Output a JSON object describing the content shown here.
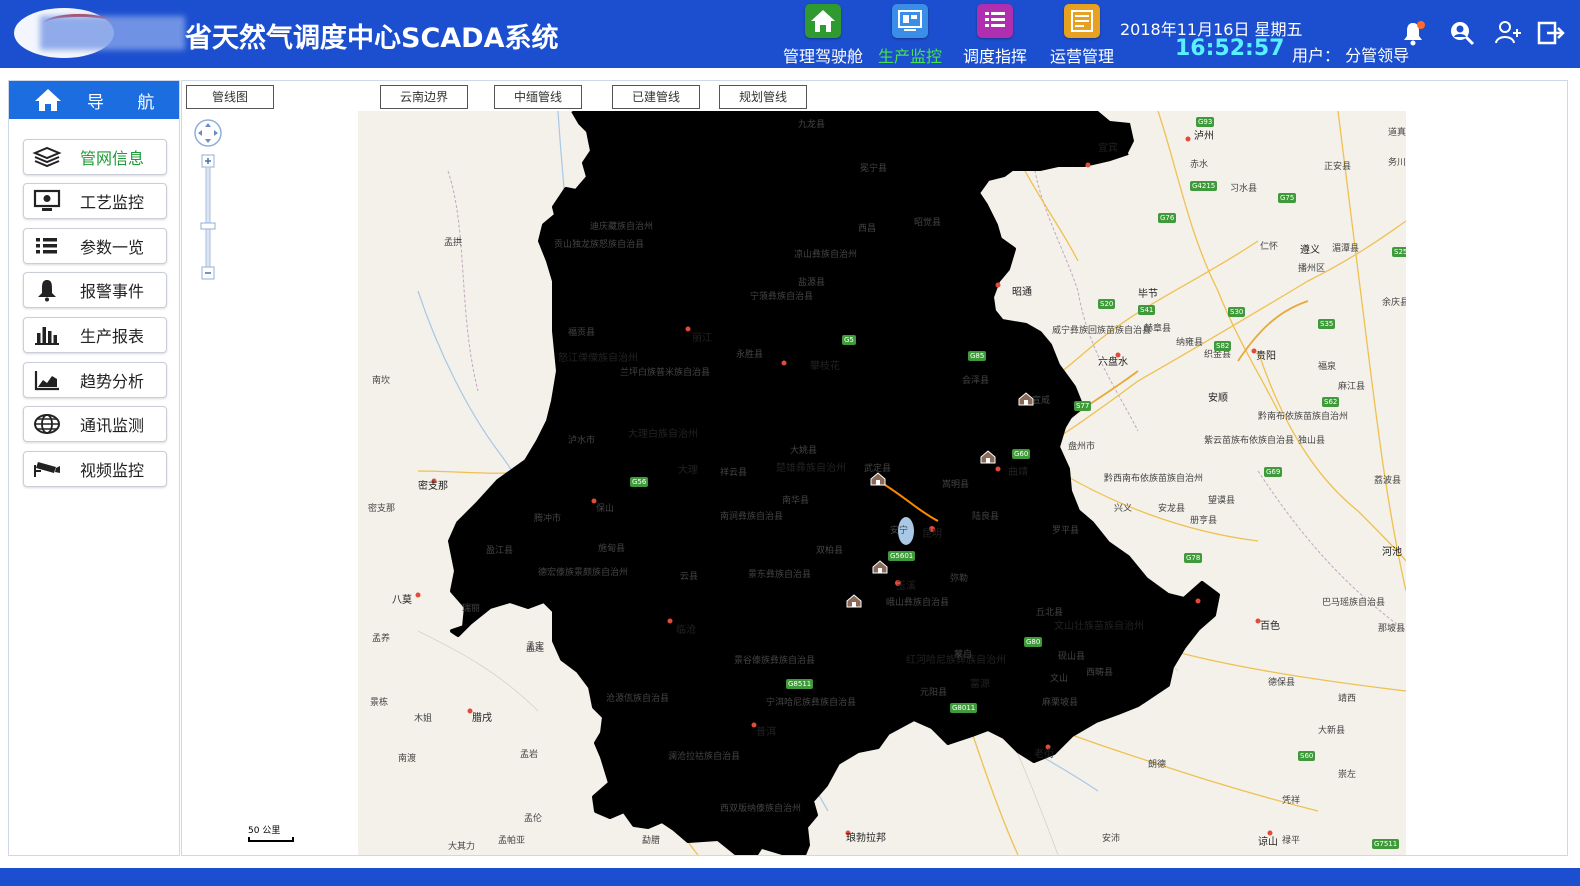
{
  "header": {
    "title": "省天然气调度中心SCADA系统",
    "nav": [
      {
        "label": "管理驾驶舱",
        "icon": "home-icon",
        "color": "#2f9a2f",
        "active": false
      },
      {
        "label": "生产监控",
        "icon": "monitor-screen-icon",
        "color": "#3a8ee8",
        "active": true
      },
      {
        "label": "调度指挥",
        "icon": "list-icon",
        "color": "#b02fb0",
        "active": false
      },
      {
        "label": "运营管理",
        "icon": "document-icon",
        "color": "#e8a020",
        "active": false
      }
    ],
    "date": "2018年11月16日  星期五",
    "time": "16:52:57",
    "user": "用户： 分管领导",
    "icons": [
      "bell-icon",
      "user-search-icon",
      "users-icon",
      "logout-icon"
    ]
  },
  "sidebar": {
    "title": "导 航",
    "items": [
      {
        "label": "管网信息",
        "icon": "layers-icon",
        "active": true
      },
      {
        "label": "工艺监控",
        "icon": "monitor-icon",
        "active": false
      },
      {
        "label": "参数一览",
        "icon": "list-icon",
        "active": false
      },
      {
        "label": "报警事件",
        "icon": "bell-icon",
        "active": false
      },
      {
        "label": "生产报表",
        "icon": "bar-chart-icon",
        "active": false
      },
      {
        "label": "趋势分析",
        "icon": "trend-chart-icon",
        "active": false
      },
      {
        "label": "通讯监测",
        "icon": "globe-icon",
        "active": false
      },
      {
        "label": "视频监控",
        "icon": "camera-icon",
        "active": false
      }
    ]
  },
  "tabs": [
    "管线图",
    "云南边界",
    "中缅管线",
    "已建管线",
    "规划管线"
  ],
  "map": {
    "scale": "50 公里",
    "places": [
      "九龙县",
      "冕宁县",
      "西昌",
      "昭觉县",
      "凉山彝族自治州",
      "盐源县",
      "宁蒗彝族自治县",
      "攀枝花",
      "永胜县",
      "丽江",
      "迪庆藏族自治州",
      "贡山独龙族怒族自治县",
      "福贡县",
      "怒江傈僳族自治州",
      "兰坪白族普米族自治县",
      "泸水市",
      "大理白族自治州",
      "大理",
      "祥云县",
      "大姚县",
      "楚雄彝族自治州",
      "武定县",
      "南华县",
      "南涧彝族自治县",
      "双柏县",
      "安宁",
      "昆明",
      "玉溪",
      "峨山彝族自治县",
      "景东彝族自治县",
      "云县",
      "临沧",
      "保山",
      "腾冲市",
      "施甸县",
      "盈江县",
      "德宏傣族景颇族自治州",
      "瑞丽",
      "孟连",
      "普洱",
      "景谷傣族彝族自治县",
      "宁洱哈尼族彝族自治县",
      "澜沧拉祜族自治县",
      "西双版纳傣族自治州",
      "勐腊",
      "孟定",
      "沧源佤族自治县",
      "元阳县",
      "红河哈尼族彝族自治州",
      "蒙自",
      "文山壮族苗族自治州",
      "文山",
      "丘北县",
      "砚山县",
      "西畴县",
      "麻栗坡县",
      "老街",
      "弥勒",
      "陆良县",
      "曲靖",
      "会泽县",
      "宣威",
      "嵩明县",
      "罗平县",
      "富源",
      "六盘水",
      "盘州市",
      "兴义",
      "安龙县",
      "黔西南布依族苗族自治州",
      "册亨县",
      "望谟县",
      "紫云苗族布依族自治县",
      "黔南布依族苗族自治州",
      "独山县",
      "安顺",
      "贵阳",
      "遵义",
      "播州区",
      "毕节",
      "纳雍县",
      "织金县",
      "威宁彝族回族苗族自治县",
      "赫章县",
      "昭通",
      "宜宾",
      "泸州",
      "赤水",
      "习水县",
      "仁怀",
      "正安县",
      "道真仡佬族苗族自治县",
      "务川仡佬族苗族自治县",
      "湄潭县",
      "余庆县",
      "福泉",
      "麻江县",
      "荔波县",
      "河池",
      "巴马瑶族自治县",
      "百色",
      "德保县",
      "靖西",
      "那坡县",
      "大新县",
      "崇左",
      "凭祥",
      "谅山",
      "禄平",
      "安沛",
      "朗德",
      "琅勃拉邦",
      "勐腊",
      "密支那",
      "八莫",
      "腊戌",
      "孟拱",
      "南坎",
      "孟养",
      "木姐",
      "南渡",
      "孟岩",
      "景栋",
      "孟伦",
      "孟帕亚",
      "大其力",
      "密支那",
      "孟宽"
    ],
    "highways": [
      "G93",
      "G85",
      "G4215",
      "G76",
      "G75",
      "G56",
      "S25",
      "S30",
      "G5",
      "G60",
      "G80",
      "G78",
      "G8511",
      "G5601",
      "G8011",
      "G7511",
      "S62",
      "S77",
      "S82",
      "S20",
      "S35",
      "S41",
      "G69",
      "S60"
    ]
  }
}
